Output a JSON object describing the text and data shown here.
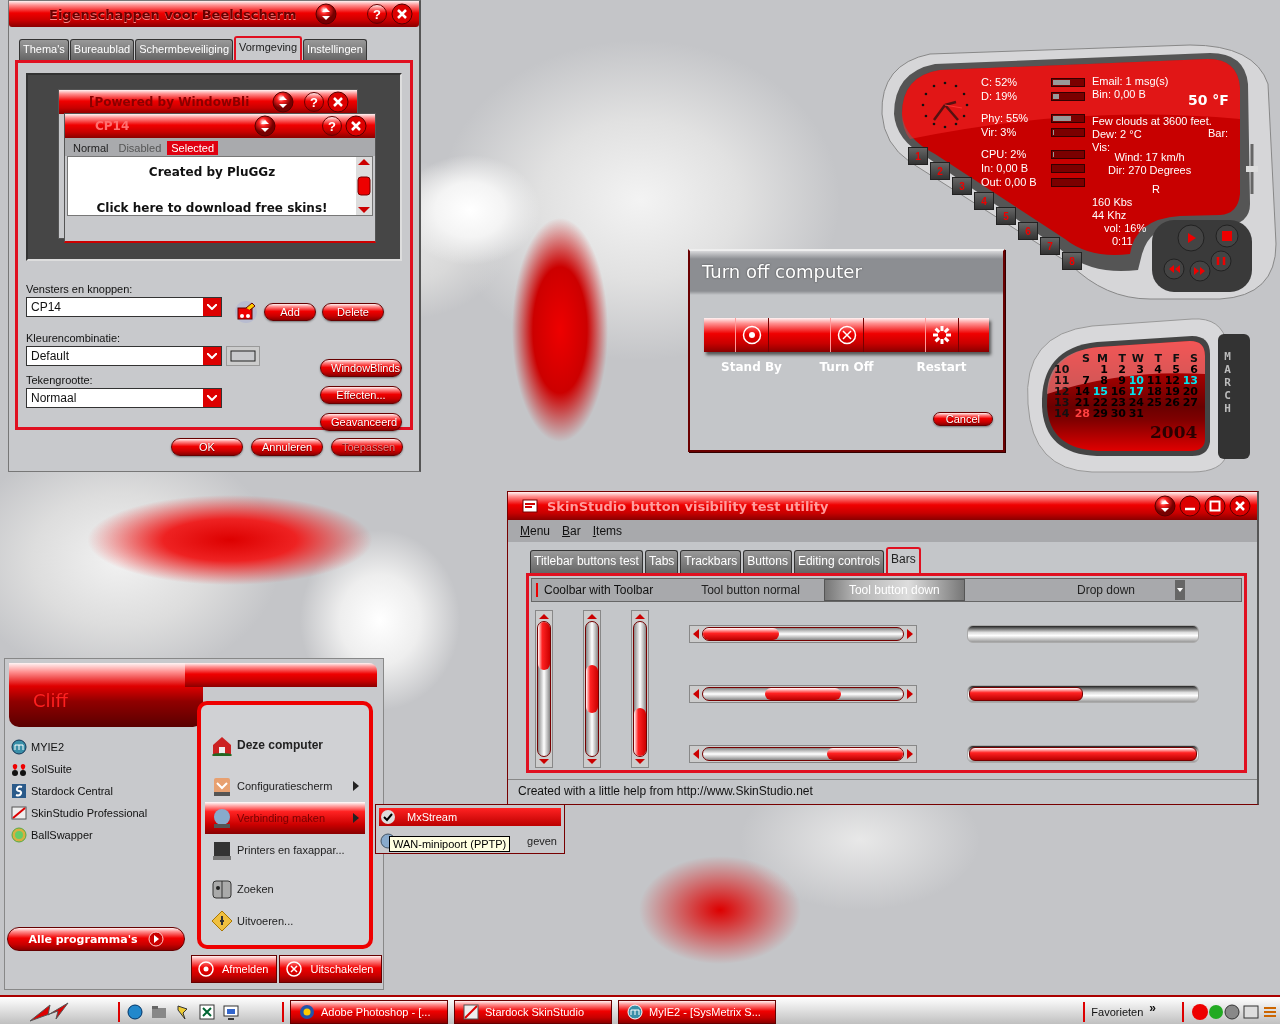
{
  "display_properties": {
    "title": "Eigenschappen voor Beeldscherm",
    "help": "?",
    "tabs": [
      {
        "label": "Thema's",
        "selected": false
      },
      {
        "label": "Bureaublad",
        "selected": false
      },
      {
        "label": "Schermbeveiliging",
        "selected": false
      },
      {
        "label": "Vormgeving",
        "selected": true
      },
      {
        "label": "Instellingen",
        "selected": false
      }
    ],
    "preview": {
      "back_title": "[Powered by WindowBli",
      "back_help": "?",
      "title": "CP14",
      "help": "?",
      "menu": [
        {
          "label": "Normal",
          "disabled": false,
          "selected": false
        },
        {
          "label": "Disabled",
          "disabled": true,
          "selected": false
        },
        {
          "label": "Selected",
          "disabled": false,
          "selected": true
        }
      ],
      "lines": [
        "Created by PluGGz",
        "Click here to download free skins!"
      ]
    },
    "fields": [
      {
        "label": "Vensters en knoppen:",
        "value": "CP14"
      },
      {
        "label": "Kleurencombinatie:",
        "value": "Default"
      },
      {
        "label": "Tekengrootte:",
        "value": "Normaal"
      }
    ],
    "skin_buttons": [
      "Add",
      "Delete"
    ],
    "scheme_buttons": [
      "WindowBlinds",
      "Effecten...",
      "Geavanceerd"
    ],
    "footer_buttons": [
      {
        "label": "OK",
        "disabled": false
      },
      {
        "label": "Annuleren",
        "disabled": false
      },
      {
        "label": "Toepassen",
        "disabled": true
      }
    ]
  },
  "system_meter": {
    "stats": [
      {
        "label": "C: 52%",
        "level": 0.52
      },
      {
        "label": "D: 19%",
        "level": 0.19
      },
      {
        "label": "Phy: 55%",
        "level": 0.55
      },
      {
        "label": "Vir: 3%",
        "level": 0.03
      },
      {
        "label": "CPU: 2%",
        "level": 0.02
      },
      {
        "label": "In: 0,00 B",
        "level": 0
      },
      {
        "label": "Out: 0,00 B",
        "level": 0
      }
    ],
    "mail": [
      "Email: 1 msg(s)",
      "Bin: 0,00 B"
    ],
    "temperature": "50 °F",
    "weather": [
      "Few clouds at 3600 feet.",
      "Dew: 2 °C",
      "Vis:"
    ],
    "pressure": "Bar:",
    "wind": [
      "Wind: 17 km/h",
      "Dir: 270 Degrees"
    ],
    "media": [
      "R",
      "160 Kbs",
      "44 Khz",
      "vol: 16%",
      "0:11"
    ],
    "presets": [
      "1",
      "2",
      "3",
      "4",
      "5",
      "6",
      "7",
      "8"
    ]
  },
  "turn_off": {
    "title": "Turn off computer",
    "options": [
      {
        "label": "Stand By",
        "kind": "standby"
      },
      {
        "label": "Turn Off",
        "kind": "off"
      },
      {
        "label": "Restart",
        "kind": "restart"
      }
    ],
    "cancel": "Cancel"
  },
  "calendar": {
    "month": "MARCH",
    "year": "2004",
    "weekdays": [
      "S",
      "M",
      "T",
      "W",
      "T",
      "F",
      "S"
    ],
    "weeks": [
      {
        "week": "10",
        "days": [
          {
            "day": "1",
            "color": "#000000"
          },
          {
            "day": "2",
            "color": "#000000"
          },
          {
            "day": "3",
            "color": "#000000"
          },
          {
            "day": "4",
            "color": "#000000"
          },
          {
            "day": "5",
            "color": "#000000"
          },
          {
            "day": "6",
            "color": "#000000"
          }
        ]
      },
      {
        "week": "11",
        "days": [
          {
            "day": "7",
            "color": "#000000"
          },
          {
            "day": "8",
            "color": "#000000"
          },
          {
            "day": "9",
            "color": "#000000"
          },
          {
            "day": "10",
            "color": "#00e5f0"
          },
          {
            "day": "11",
            "color": "#000000"
          },
          {
            "day": "12",
            "color": "#000000"
          },
          {
            "day": "13",
            "color": "#00e5f0"
          }
        ]
      },
      {
        "week": "12",
        "days": [
          {
            "day": "14",
            "color": "#000000"
          },
          {
            "day": "15",
            "color": "#00e5f0"
          },
          {
            "day": "16",
            "color": "#000000"
          },
          {
            "day": "17",
            "color": "#00e5f0"
          },
          {
            "day": "18",
            "color": "#000000"
          },
          {
            "day": "19",
            "color": "#000000"
          },
          {
            "day": "20",
            "color": "#000000"
          }
        ]
      },
      {
        "week": "13",
        "days": [
          {
            "day": "21",
            "color": "#000000"
          },
          {
            "day": "22",
            "color": "#000000"
          },
          {
            "day": "23",
            "color": "#000000"
          },
          {
            "day": "24",
            "color": "#000000"
          },
          {
            "day": "25",
            "color": "#000000"
          },
          {
            "day": "26",
            "color": "#000000"
          },
          {
            "day": "27",
            "color": "#000000"
          }
        ]
      },
      {
        "week": "14",
        "days": [
          {
            "day": "28",
            "color": "#ff4040"
          },
          {
            "day": "29",
            "color": "#000000"
          },
          {
            "day": "30",
            "color": "#000000"
          },
          {
            "day": "31",
            "color": "#000000"
          }
        ]
      }
    ]
  },
  "skinstudio": {
    "title": "SkinStudio button visibility test utility",
    "menu": [
      "Menu",
      "Bar",
      "Items"
    ],
    "tabs": [
      {
        "label": "Titlebar buttons test",
        "selected": false
      },
      {
        "label": "Tabs",
        "selected": false
      },
      {
        "label": "Trackbars",
        "selected": false
      },
      {
        "label": "Buttons",
        "selected": false
      },
      {
        "label": "Editing controls",
        "selected": false
      },
      {
        "label": "Bars",
        "selected": true
      }
    ],
    "toolbar": {
      "label": "Coolbar with Toolbar",
      "buttons": [
        {
          "label": "Tool button normal",
          "pressed": false
        },
        {
          "label": "Tool button down",
          "pressed": true
        }
      ],
      "dropdown": "Drop down"
    },
    "progress_bars": [
      {
        "level": 0
      },
      {
        "level": 0.5
      },
      {
        "level": 1
      }
    ],
    "status": "Created with a little help from http://www.SkinStudio.net"
  },
  "start_menu": {
    "user": "Cliff",
    "programs": [
      "MYIE2",
      "SolSuite",
      "Stardock Central",
      "SkinStudio Professional",
      "BallSwapper"
    ],
    "all_programs": "Alle programma's",
    "places": [
      {
        "label": "Deze computer",
        "selected": false,
        "has_submenu": false
      },
      {
        "label": "Configuratiescherm",
        "selected": false,
        "has_submenu": true
      },
      {
        "label": "Verbinding maken",
        "selected": true,
        "has_submenu": true
      },
      {
        "label": "Printers en faxappar...",
        "selected": false,
        "has_submenu": false
      },
      {
        "label": "Zoeken",
        "selected": false,
        "has_submenu": false
      },
      {
        "label": "Uitvoeren...",
        "selected": false,
        "has_submenu": false
      }
    ],
    "submenu": [
      {
        "label": "MxStream",
        "selected": true
      },
      {
        "label": "geven",
        "selected": false
      }
    ],
    "tooltip": "WAN-minipoort (PPTP)",
    "actions": [
      {
        "label": "Afmelden",
        "kind": "logoff"
      },
      {
        "label": "Uitschakelen",
        "kind": "shutdown"
      }
    ]
  },
  "taskbar": {
    "tasks": [
      "Adobe Photoshop - [...",
      "Stardock SkinStudio",
      "MyIE2 - [SysMetrix S..."
    ],
    "favorites": "Favorieten",
    "chevron": "»"
  }
}
